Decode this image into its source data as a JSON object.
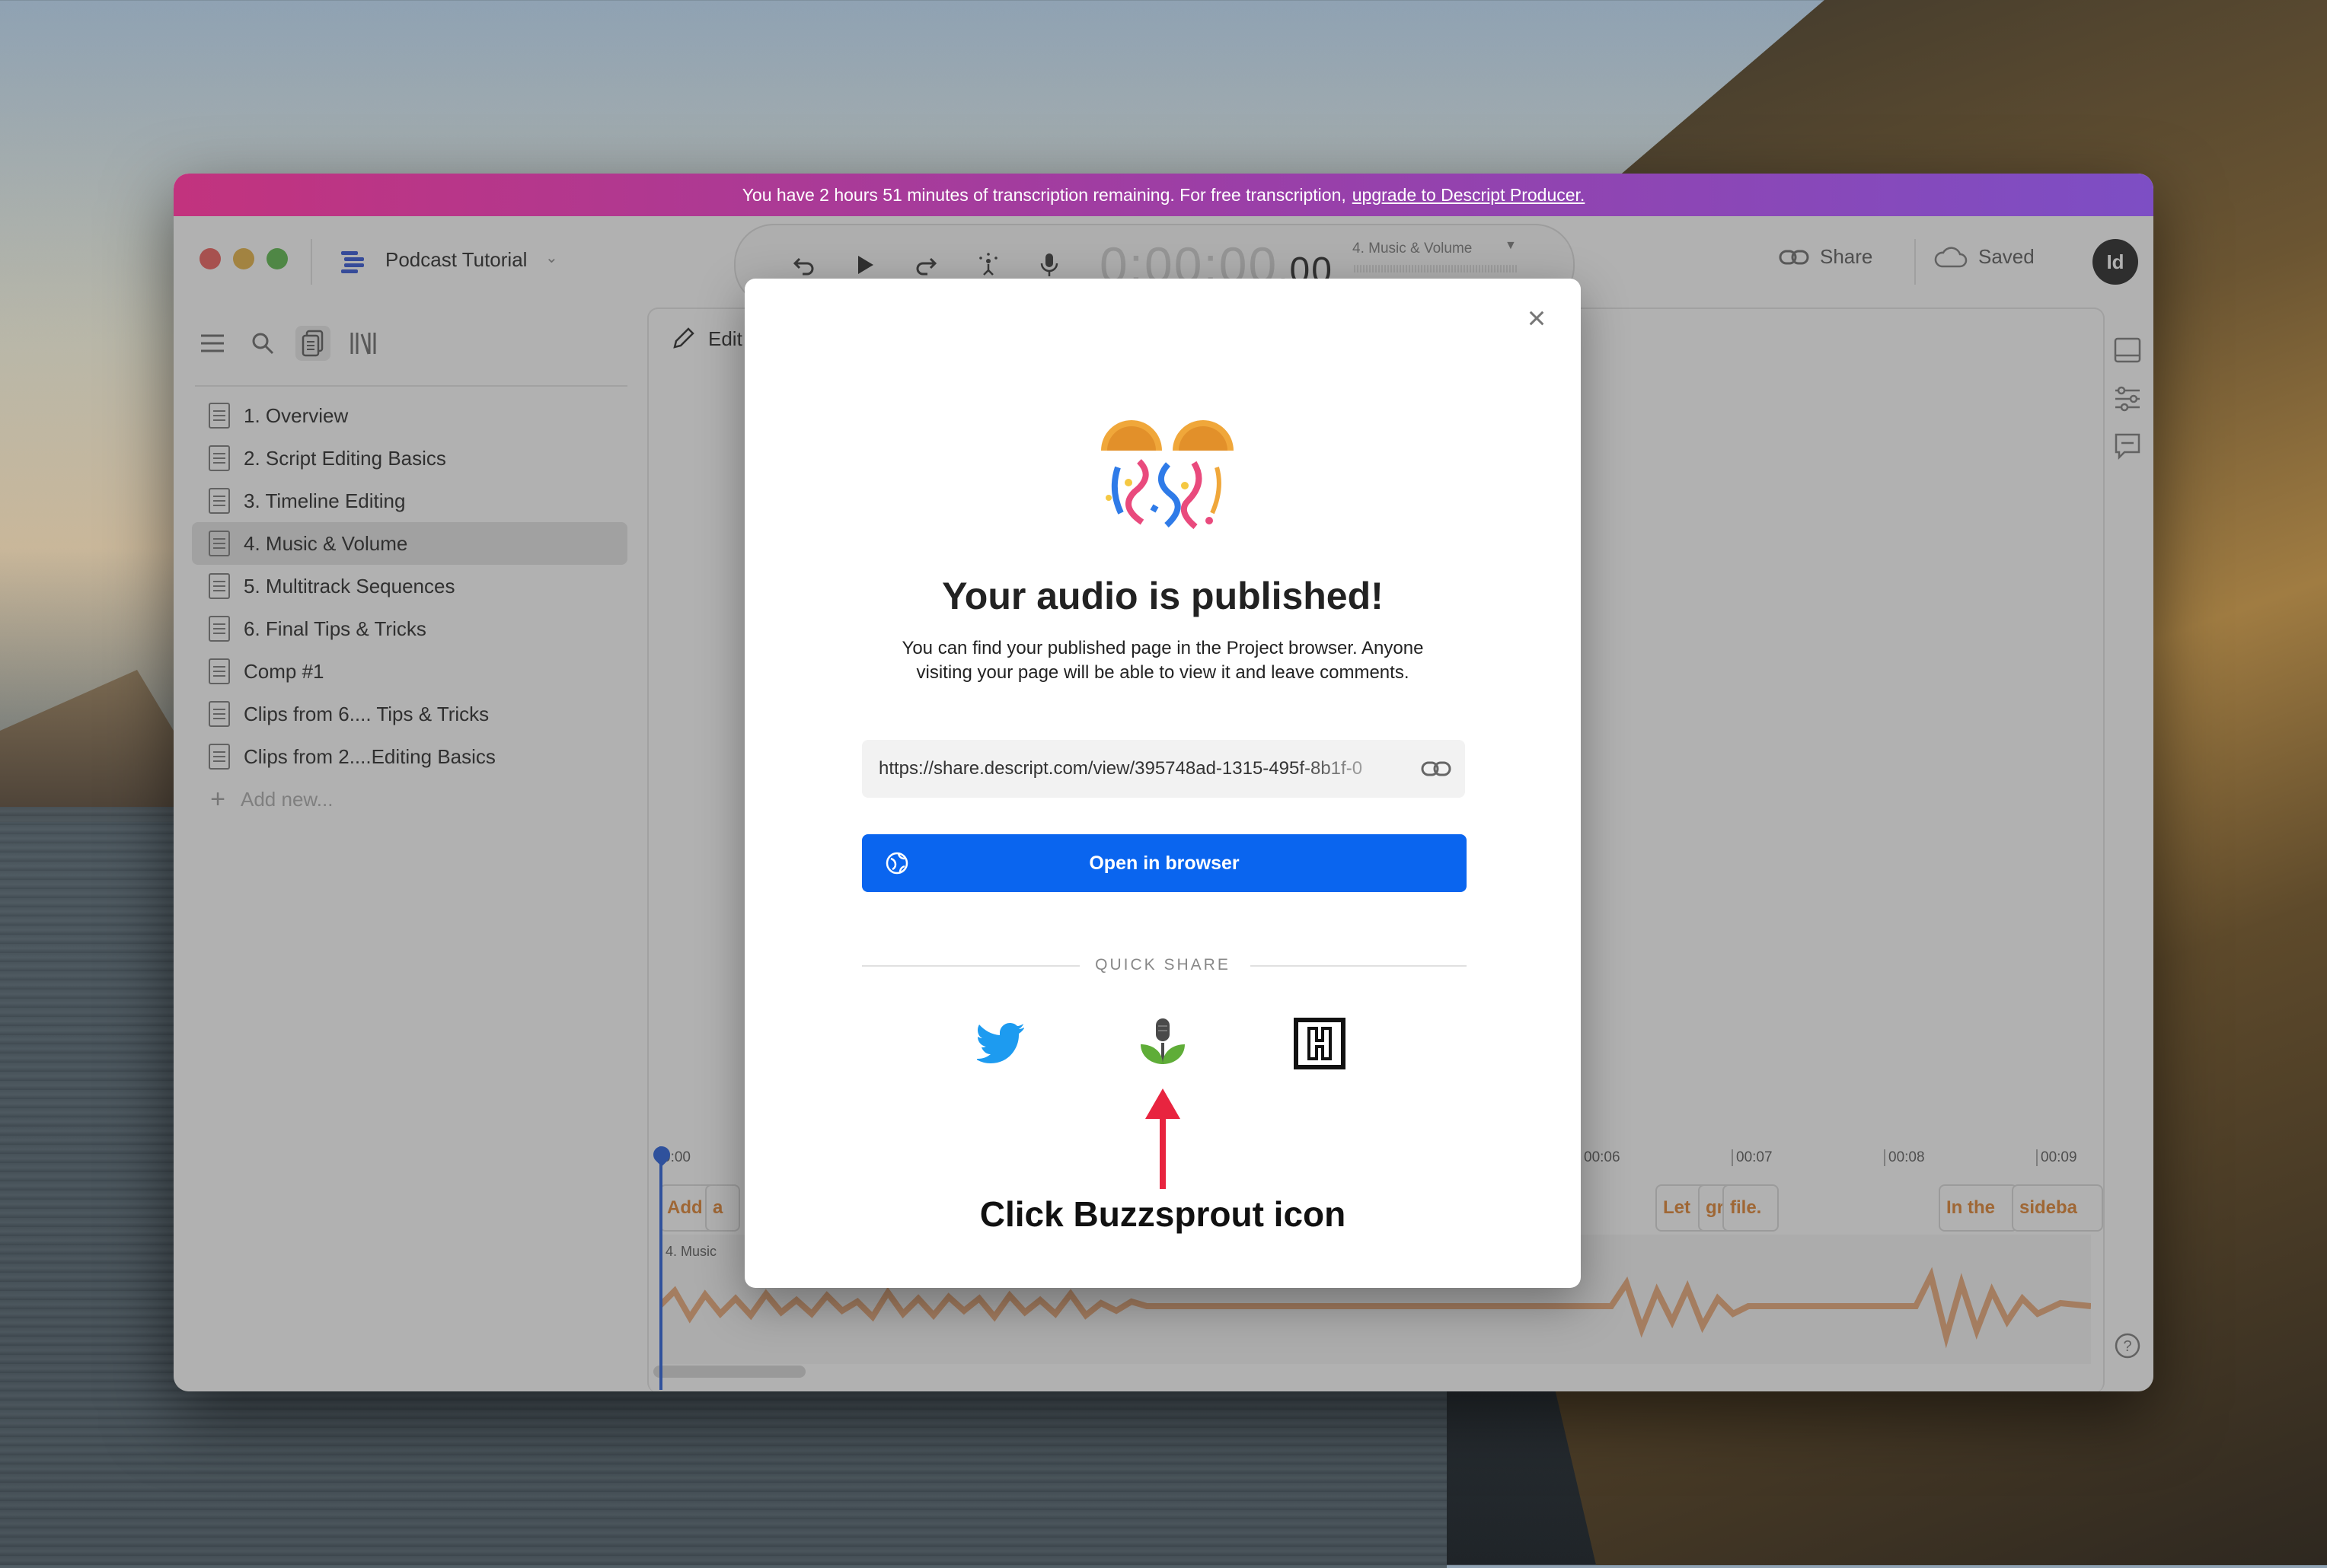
{
  "banner": {
    "text": "You have 2 hours 51 minutes of transcription remaining. For free transcription,",
    "link": "upgrade to Descript Producer."
  },
  "header": {
    "project_name": "Podcast Tutorial",
    "timecode_main": "0:00:00",
    "timecode_frac": ".00",
    "sequence_name": "4. Music & Volume",
    "share_label": "Share",
    "saved_label": "Saved",
    "avatar_initials": "Id"
  },
  "sidebar": {
    "items": [
      {
        "label": "1. Overview"
      },
      {
        "label": "2. Script Editing Basics"
      },
      {
        "label": "3. Timeline Editing"
      },
      {
        "label": "4. Music & Volume"
      },
      {
        "label": "5. Multitrack Sequences"
      },
      {
        "label": "6. Final Tips & Tricks"
      },
      {
        "label": "Comp #1"
      },
      {
        "label": "Clips from 6.... Tips & Tricks"
      },
      {
        "label": "Clips from 2....Editing Basics"
      }
    ],
    "add_new": "Add new...",
    "selected_index": 3
  },
  "editor": {
    "edit_label": "Edit",
    "track_label": "4. Music",
    "ruler": [
      "0:00",
      "00:06",
      "00:07",
      "00:08",
      "00:09"
    ],
    "clips": [
      "Add",
      "a",
      "Let",
      "gr",
      "file.",
      "In the",
      "sideba"
    ]
  },
  "modal": {
    "title": "Your audio is published!",
    "description": "You can find your published page in the Project browser. Anyone visiting your page will be able to view it and leave comments.",
    "url": "https://share.descript.com/view/395748ad-1315-495f-8b1f-0",
    "open_button": "Open in browser",
    "quick_share_label": "QUICK SHARE",
    "share_targets": [
      "twitter-icon",
      "buzzsprout-icon",
      "headliner-icon"
    ],
    "instruction": "Click Buzzsprout icon"
  },
  "colors": {
    "banner_start": "#c2337e",
    "banner_end": "#7d4ec4",
    "primary_button": "#0a65ef",
    "twitter": "#1d9bf0",
    "buzzsprout": "#5fad38",
    "arrow": "#e8243f",
    "clip_text": "#e0802a"
  }
}
